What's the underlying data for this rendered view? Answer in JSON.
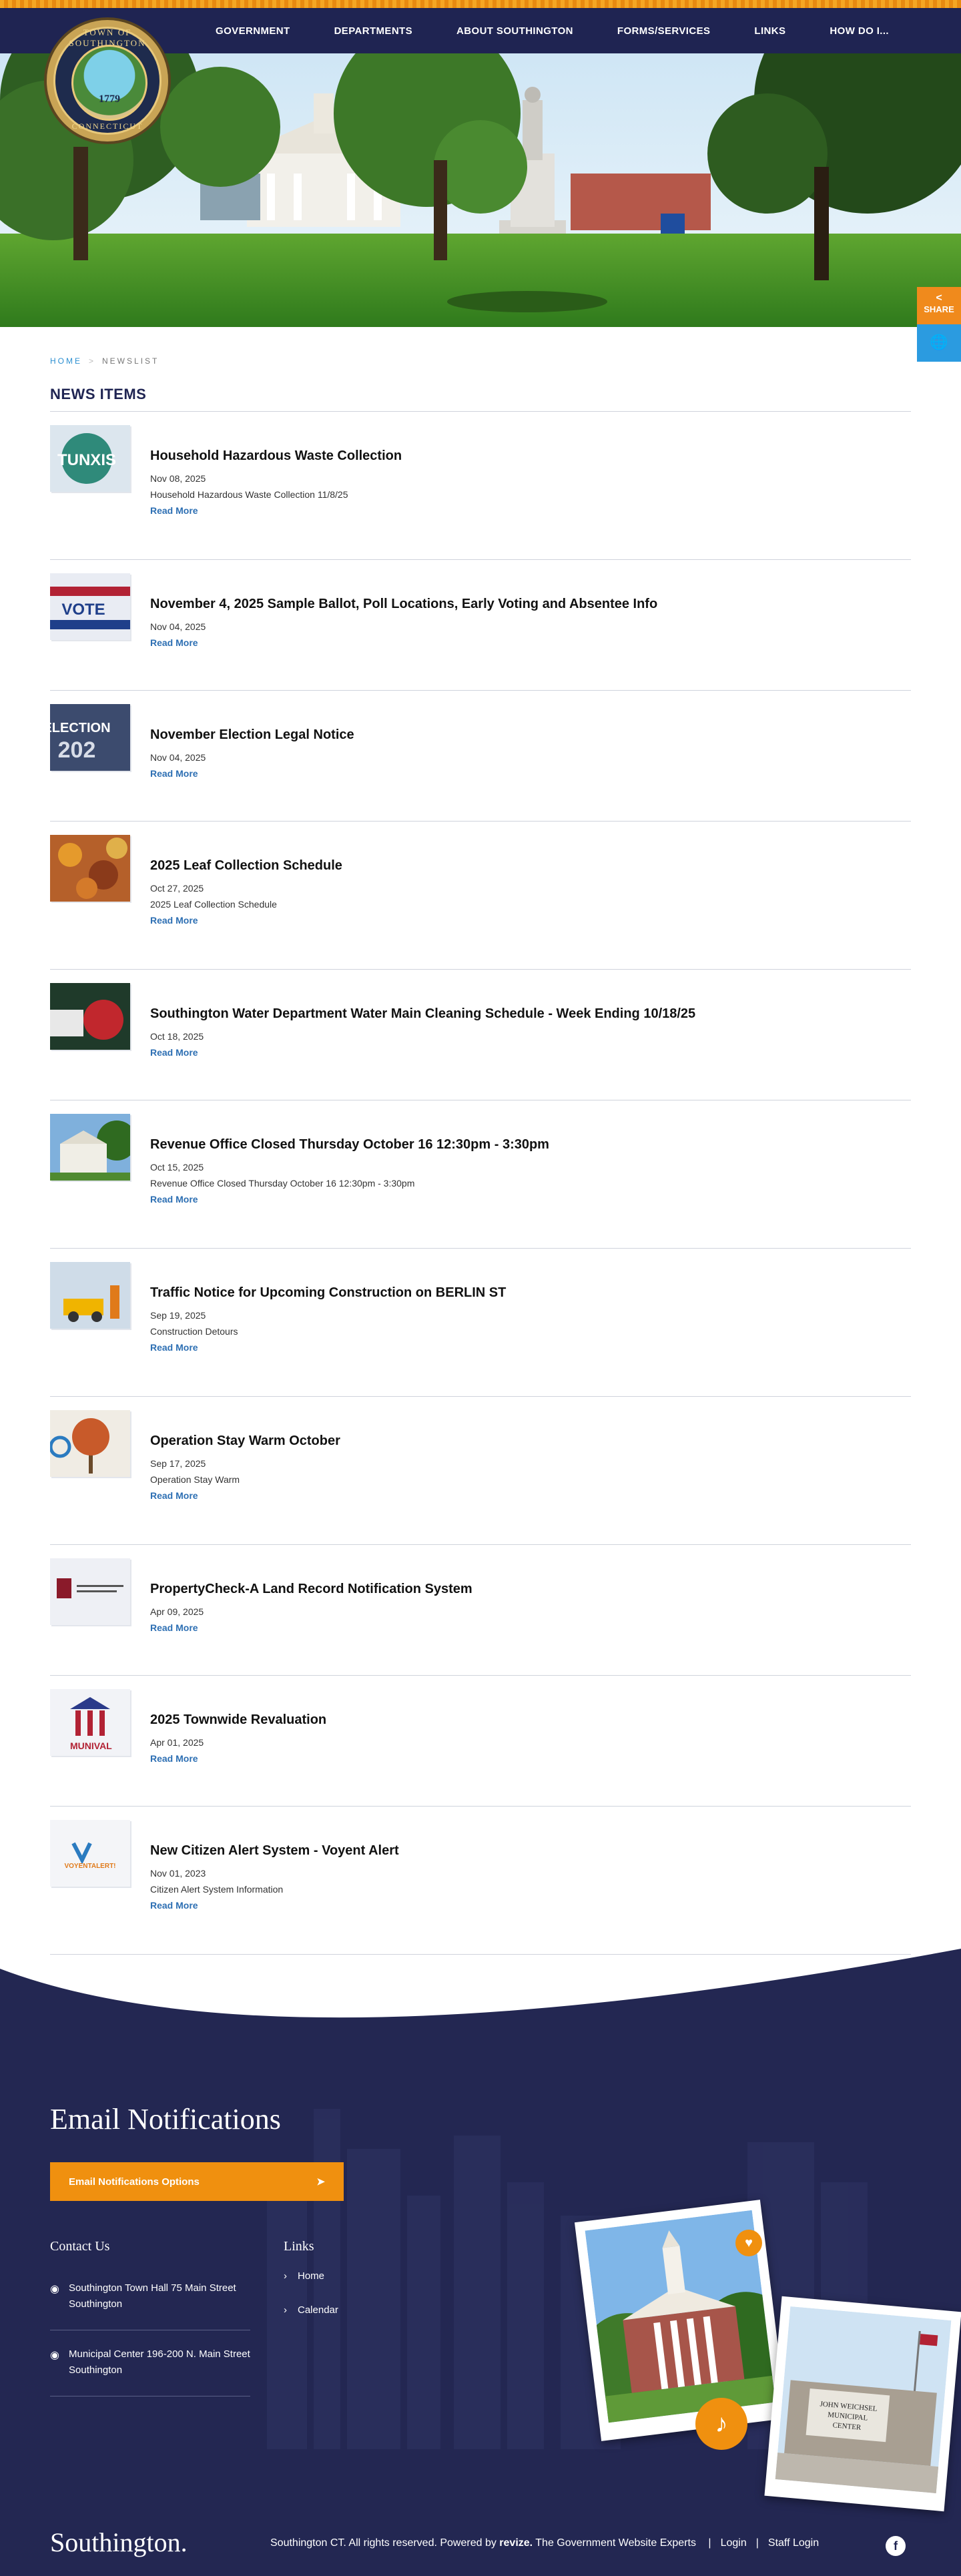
{
  "header": {
    "nav": [
      "GOVERNMENT",
      "DEPARTMENTS",
      "ABOUT SOUTHINGTON",
      "FORMS/SERVICES",
      "LINKS",
      "HOW DO I..."
    ],
    "seal": {
      "top_text": "TOWN OF SOUTHINGTON",
      "bottom_text": "CONNECTICUT",
      "year": "1779"
    }
  },
  "sidebar_tools": {
    "share_label": "SHARE"
  },
  "breadcrumb": {
    "home": "HOME",
    "separator": ">",
    "current": "NEWSLIST"
  },
  "page_title": "NEWS ITEMS",
  "read_more_label": "Read More",
  "news": [
    {
      "title": "Household Hazardous Waste Collection",
      "date": "Nov 08, 2025",
      "desc": "Household Hazardous Waste Collection 11/8/25",
      "thumb_text": "TUNXIS"
    },
    {
      "title": "November 4, 2025 Sample Ballot, Poll Locations, Early Voting and Absentee Info",
      "date": "Nov 04, 2025",
      "desc": "",
      "thumb_text": "VOTE"
    },
    {
      "title": "November Election Legal Notice",
      "date": "Nov 04, 2025",
      "desc": "",
      "thumb_text": "ELECTION"
    },
    {
      "title": "2025 Leaf Collection Schedule",
      "date": "Oct 27, 2025",
      "desc": "2025 Leaf Collection Schedule",
      "thumb_text": ""
    },
    {
      "title": "Southington Water Department Water Main Cleaning Schedule - Week Ending 10/18/25",
      "date": "Oct 18, 2025",
      "desc": "",
      "thumb_text": ""
    },
    {
      "title": "Revenue Office Closed Thursday October 16 12:30pm - 3:30pm",
      "date": "Oct 15, 2025",
      "desc": "Revenue Office Closed Thursday October 16 12:30pm - 3:30pm",
      "thumb_text": ""
    },
    {
      "title": "Traffic Notice for Upcoming Construction on BERLIN ST",
      "date": "Sep 19, 2025",
      "desc": "Construction Detours",
      "thumb_text": ""
    },
    {
      "title": "Operation Stay Warm October",
      "date": "Sep 17, 2025",
      "desc": "Operation Stay Warm",
      "thumb_text": ""
    },
    {
      "title": "PropertyCheck-A Land Record Notification System",
      "date": "Apr 09, 2025",
      "desc": "",
      "thumb_text": ""
    },
    {
      "title": "2025 Townwide Revaluation",
      "date": "Apr 01, 2025",
      "desc": "",
      "thumb_text": "MUNIVAL"
    },
    {
      "title": "New Citizen Alert System - Voyent Alert",
      "date": "Nov 01, 2023",
      "desc": "Citizen Alert System Information",
      "thumb_text": "VOYENTALERT!"
    }
  ],
  "footer": {
    "email_title": "Email Notifications",
    "email_button": "Email Notifications Options",
    "contact_title": "Contact Us",
    "addresses": [
      "Southington Town Hall 75 Main Street Southington",
      "Municipal Center 196-200 N. Main Street Southington"
    ],
    "links_title": "Links",
    "links": [
      "Home",
      "Calendar"
    ],
    "photo2_sign": "JOHN WEICHSEL MUNICIPAL CENTER",
    "brand": "Southington.",
    "copyright": "Southington CT. All rights reserved. Powered by",
    "powered_brand": "revize.",
    "powered_tail": "The Government Website Experts",
    "login": "Login",
    "staff_login": "Staff Login",
    "social": "f"
  }
}
